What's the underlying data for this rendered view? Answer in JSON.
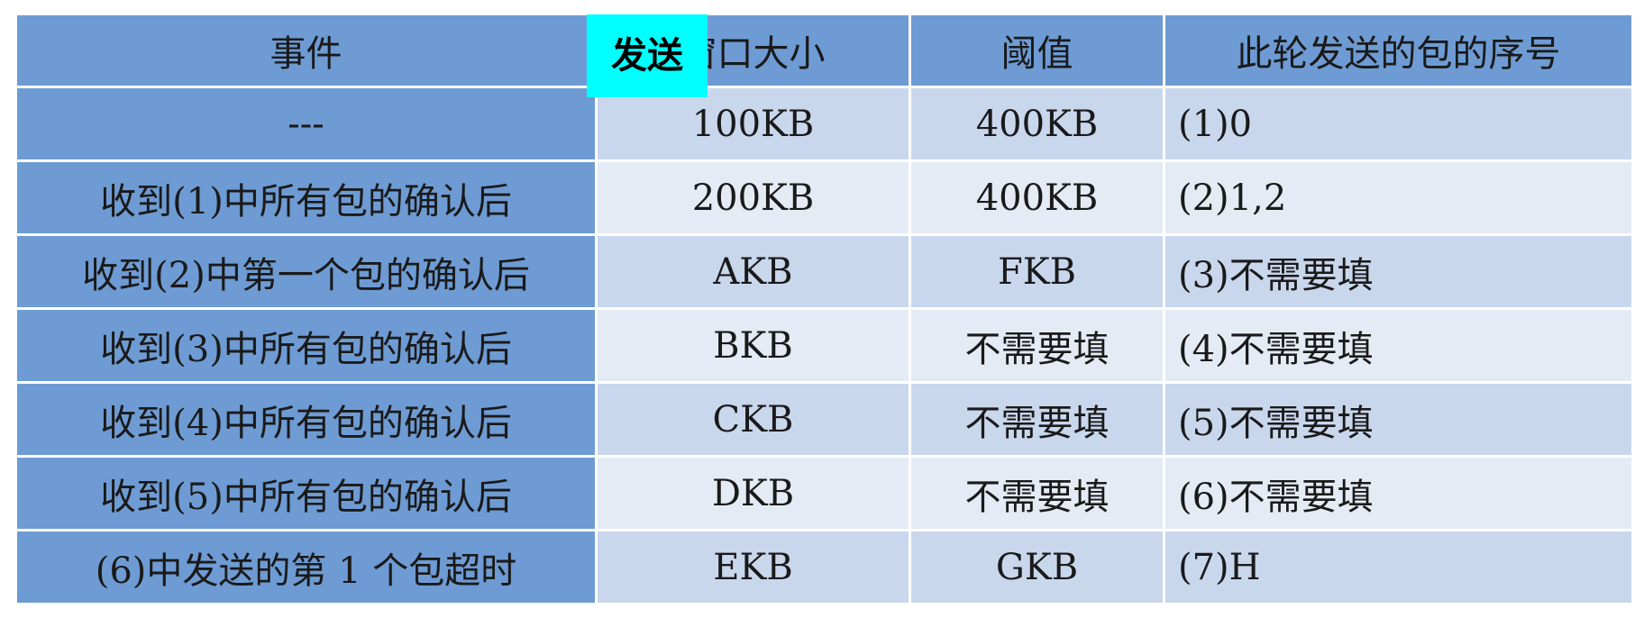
{
  "highlight": {
    "text": "发送"
  },
  "table": {
    "headers": [
      "事件",
      "窗口大小",
      "阈值",
      "此轮发送的包的序号"
    ],
    "rows": [
      [
        "---",
        "100KB",
        "400KB",
        "(1)0"
      ],
      [
        "收到(1)中所有包的确认后",
        "200KB",
        "400KB",
        "(2)1,2"
      ],
      [
        "收到(2)中第一个包的确认后",
        "AKB",
        "FKB",
        "(3)不需要填"
      ],
      [
        "收到(3)中所有包的确认后",
        "BKB",
        "不需要填",
        "(4)不需要填"
      ],
      [
        "收到(4)中所有包的确认后",
        "CKB",
        "不需要填",
        "(5)不需要填"
      ],
      [
        "收到(5)中所有包的确认后",
        "DKB",
        "不需要填",
        "(6)不需要填"
      ],
      [
        "(6)中发送的第 1 个包超时",
        "EKB",
        "GKB",
        "(7)H"
      ]
    ]
  },
  "colors": {
    "header_bg": "#6e9bd3",
    "row_odd_bg": "#c9d7ed",
    "row_even_bg": "#e4ebf5",
    "highlight_bg": "#00ffff"
  }
}
